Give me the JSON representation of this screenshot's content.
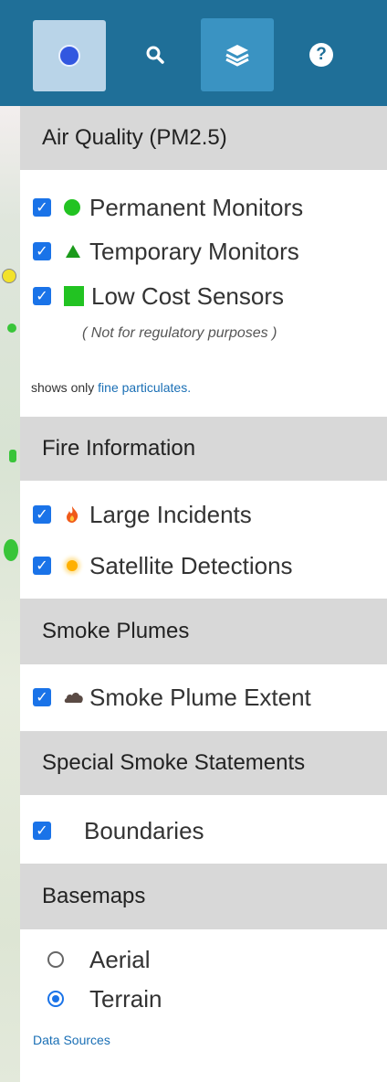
{
  "toolbar": {
    "buttons": [
      {
        "name": "location-dot-icon",
        "label": ""
      },
      {
        "name": "search-icon",
        "glyph": "🔍"
      },
      {
        "name": "layers-icon",
        "glyph": "≋"
      },
      {
        "name": "help-icon",
        "glyph": "?"
      }
    ]
  },
  "sections": {
    "air_quality": {
      "title": "Air Quality (PM2.5)",
      "items": [
        {
          "label": "Permanent Monitors",
          "checked": true,
          "symbol": "green-circle"
        },
        {
          "label": "Temporary Monitors",
          "checked": true,
          "symbol": "green-triangle"
        },
        {
          "label": "Low Cost Sensors",
          "checked": true,
          "symbol": "green-square"
        }
      ],
      "note": "( Not for regulatory purposes )",
      "shows_prefix": "shows only",
      "shows_link": "fine particulates."
    },
    "fire": {
      "title": "Fire Information",
      "items": [
        {
          "label": "Large Incidents",
          "checked": true,
          "symbol": "flame"
        },
        {
          "label": "Satellite Detections",
          "checked": true,
          "symbol": "sun-dot"
        }
      ]
    },
    "smoke": {
      "title": "Smoke Plumes",
      "items": [
        {
          "label": "Smoke Plume Extent",
          "checked": true,
          "symbol": "cloud"
        }
      ]
    },
    "statements": {
      "title": "Special Smoke Statements",
      "items": [
        {
          "label": "Boundaries",
          "checked": true
        }
      ]
    },
    "basemaps": {
      "title": "Basemaps",
      "options": [
        {
          "label": "Aerial",
          "selected": false
        },
        {
          "label": "Terrain",
          "selected": true
        }
      ],
      "sources_link": "Data Sources"
    }
  },
  "colors": {
    "toolbar": "#1f6f98",
    "active_button": "#b9d4e8",
    "header_bg": "#d8d8d8",
    "checkbox": "#1a73e8",
    "sensor_green": "#22c322"
  }
}
